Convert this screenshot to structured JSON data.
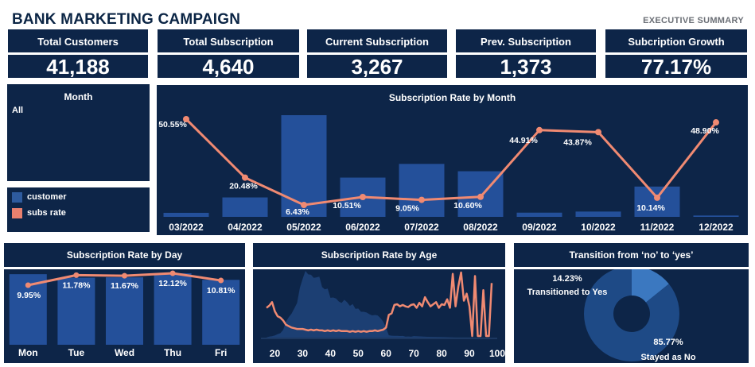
{
  "header": {
    "title": "BANK MARKETING CAMPAIGN",
    "subtitle": "EXECUTIVE SUMMARY"
  },
  "kpis": [
    {
      "label": "Total  Customers",
      "value": "41,188"
    },
    {
      "label": "Total Subscription",
      "value": "4,640"
    },
    {
      "label": "Current Subscription",
      "value": "3,267"
    },
    {
      "label": "Prev. Subscription",
      "value": "1,373"
    },
    {
      "label": "Subcription Growth",
      "value": "77.17%"
    }
  ],
  "filter": {
    "label": "Month",
    "value": "All"
  },
  "legend": {
    "items": [
      {
        "label": "customer",
        "color": "#2e5b9e"
      },
      {
        "label": "subs rate",
        "color": "#e8806e"
      }
    ]
  },
  "colors": {
    "panel": "#0d2548",
    "bar": "#24509a",
    "line": "#f08a72",
    "donut_main": "#1e4a86",
    "donut_minor": "#3b78c0"
  },
  "chart_data": [
    {
      "id": "month",
      "type": "bar",
      "title": "Subscription Rate by Month",
      "categories": [
        "03/2022",
        "04/2022",
        "05/2022",
        "06/2022",
        "07/2022",
        "08/2022",
        "09/2022",
        "10/2022",
        "11/2022",
        "12/2022"
      ],
      "series": [
        {
          "name": "customer",
          "values": [
            546,
            2632,
            13769,
            5318,
            7174,
            6178,
            570,
            718,
            4101,
            182
          ]
        },
        {
          "name": "subs rate",
          "values": [
            50.55,
            20.48,
            6.43,
            10.51,
            9.05,
            10.6,
            44.91,
            43.87,
            10.14,
            48.9
          ]
        }
      ],
      "data_labels": [
        "50.55%",
        "20.48%",
        "6.43%",
        "10.51%",
        "9.05%",
        "10.60%",
        "44.91%",
        "43.87%",
        "10.14%",
        "48.90%"
      ]
    },
    {
      "id": "day",
      "type": "bar",
      "title": "Subscription Rate by Day",
      "categories": [
        "Mon",
        "Tue",
        "Wed",
        "Thu",
        "Fri"
      ],
      "series": [
        {
          "name": "customer",
          "values": [
            8514,
            8090,
            8134,
            8623,
            7827
          ]
        },
        {
          "name": "subs rate",
          "values": [
            9.95,
            11.78,
            11.67,
            12.12,
            10.81
          ]
        }
      ],
      "data_labels": [
        "9.95%",
        "11.78%",
        "11.67%",
        "12.12%",
        "10.81%"
      ]
    },
    {
      "id": "age",
      "type": "area",
      "title": "Subscription Rate by Age",
      "x_ticks": [
        20,
        30,
        40,
        50,
        60,
        70,
        80,
        90,
        100
      ],
      "xlim": [
        15,
        100
      ],
      "series": [
        {
          "name": "customer",
          "x": [
            17,
            18,
            19,
            20,
            21,
            22,
            23,
            24,
            25,
            26,
            27,
            28,
            29,
            30,
            31,
            32,
            33,
            34,
            35,
            36,
            37,
            38,
            39,
            40,
            41,
            42,
            43,
            44,
            45,
            46,
            47,
            48,
            49,
            50,
            51,
            52,
            53,
            54,
            55,
            56,
            57,
            58,
            59,
            60,
            61,
            62,
            63,
            64,
            65,
            66,
            67,
            68,
            69,
            70,
            75,
            80,
            85,
            90,
            95,
            98
          ],
          "values": [
            5,
            28,
            42,
            65,
            102,
            129,
            226,
            463,
            598,
            698,
            851,
            1012,
            1453,
            1714,
            1947,
            1846,
            1833,
            1745,
            1759,
            1780,
            1475,
            1407,
            1432,
            1161,
            1171,
            1142,
            1055,
            1011,
            1103,
            1030,
            928,
            979,
            839,
            849,
            754,
            754,
            733,
            684,
            648,
            660,
            646,
            571,
            463,
            283,
            70,
            55,
            53,
            52,
            45,
            48,
            30,
            33,
            27,
            44,
            24,
            17,
            7,
            5,
            2,
            1
          ]
        },
        {
          "name": "subs rate",
          "x": [
            17,
            18,
            19,
            20,
            21,
            22,
            23,
            24,
            25,
            26,
            27,
            28,
            29,
            30,
            31,
            32,
            33,
            34,
            35,
            36,
            37,
            38,
            39,
            40,
            41,
            42,
            43,
            44,
            45,
            46,
            47,
            48,
            49,
            50,
            51,
            52,
            53,
            54,
            55,
            56,
            57,
            58,
            59,
            60,
            61,
            62,
            63,
            64,
            65,
            66,
            67,
            68,
            69,
            70,
            71,
            72,
            73,
            74,
            75,
            76,
            77,
            78,
            79,
            80,
            81,
            82,
            83,
            84,
            85,
            86,
            87,
            88,
            89,
            90,
            91,
            92,
            93,
            94,
            95,
            96,
            97,
            98
          ],
          "values": [
            40,
            43,
            48,
            35,
            28,
            26,
            22,
            16,
            14,
            12,
            11,
            10,
            10,
            10,
            9,
            8,
            9,
            8,
            9,
            8,
            8,
            7,
            8,
            7,
            8,
            7,
            8,
            7,
            7,
            7,
            6,
            7,
            6,
            7,
            6,
            7,
            6,
            7,
            7,
            8,
            7,
            8,
            9,
            12,
            30,
            32,
            44,
            45,
            42,
            44,
            42,
            41,
            44,
            45,
            40,
            47,
            42,
            55,
            48,
            42,
            45,
            48,
            40,
            45,
            44,
            52,
            40,
            88,
            42,
            70,
            90,
            50,
            60,
            42,
            0,
            85,
            0,
            0,
            65,
            0,
            0,
            75
          ]
        }
      ]
    },
    {
      "id": "transition",
      "type": "pie",
      "title": "Transition from ‘no’ to ‘yes’",
      "categories": [
        "Transitioned to Yes",
        "Stayed as No"
      ],
      "values": [
        14.23,
        85.77
      ],
      "data_labels": [
        "14.23%",
        "85.77%"
      ]
    }
  ]
}
